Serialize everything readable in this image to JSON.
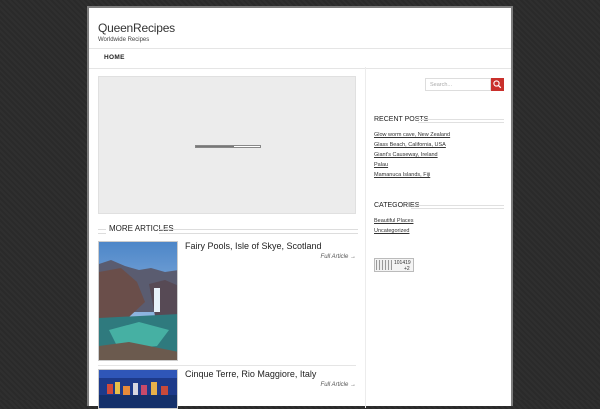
{
  "site": {
    "title": "QueenRecipes",
    "tagline": "Worldwide Recipes"
  },
  "nav": {
    "items": [
      {
        "label": "HOME"
      }
    ]
  },
  "slider": {
    "loading": 0.6
  },
  "more_articles": {
    "heading": "MORE ARTICLES",
    "articles": [
      {
        "title": "Fairy Pools, Isle of Skye, Scotland",
        "link": "Full Article →"
      },
      {
        "title": "Cinque Terre, Rio Maggiore, Italy",
        "link": "Full Article →"
      }
    ]
  },
  "sidebar": {
    "search": {
      "placeholder": "Search..."
    },
    "recent_posts": {
      "heading": "RECENT POSTS",
      "items": [
        "Glow worm cave, New Zealand",
        "Glass Beach, California, USA",
        "Giant's Causeway, Ireland",
        "Palau",
        "Mamanuca Islands, Fiji"
      ]
    },
    "categories": {
      "heading": "CATEGORIES",
      "items": [
        "Beautiful Places",
        "Uncategorized"
      ]
    },
    "counter": {
      "total": "101419",
      "today": "+2"
    }
  }
}
